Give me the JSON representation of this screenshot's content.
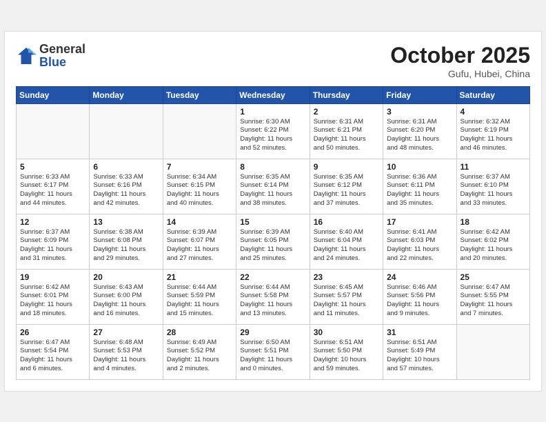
{
  "header": {
    "logo_general": "General",
    "logo_blue": "Blue",
    "month_title": "October 2025",
    "location": "Gufu, Hubei, China"
  },
  "weekdays": [
    "Sunday",
    "Monday",
    "Tuesday",
    "Wednesday",
    "Thursday",
    "Friday",
    "Saturday"
  ],
  "weeks": [
    [
      {
        "day": "",
        "info": ""
      },
      {
        "day": "",
        "info": ""
      },
      {
        "day": "",
        "info": ""
      },
      {
        "day": "1",
        "info": "Sunrise: 6:30 AM\nSunset: 6:22 PM\nDaylight: 11 hours\nand 52 minutes."
      },
      {
        "day": "2",
        "info": "Sunrise: 6:31 AM\nSunset: 6:21 PM\nDaylight: 11 hours\nand 50 minutes."
      },
      {
        "day": "3",
        "info": "Sunrise: 6:31 AM\nSunset: 6:20 PM\nDaylight: 11 hours\nand 48 minutes."
      },
      {
        "day": "4",
        "info": "Sunrise: 6:32 AM\nSunset: 6:19 PM\nDaylight: 11 hours\nand 46 minutes."
      }
    ],
    [
      {
        "day": "5",
        "info": "Sunrise: 6:33 AM\nSunset: 6:17 PM\nDaylight: 11 hours\nand 44 minutes."
      },
      {
        "day": "6",
        "info": "Sunrise: 6:33 AM\nSunset: 6:16 PM\nDaylight: 11 hours\nand 42 minutes."
      },
      {
        "day": "7",
        "info": "Sunrise: 6:34 AM\nSunset: 6:15 PM\nDaylight: 11 hours\nand 40 minutes."
      },
      {
        "day": "8",
        "info": "Sunrise: 6:35 AM\nSunset: 6:14 PM\nDaylight: 11 hours\nand 38 minutes."
      },
      {
        "day": "9",
        "info": "Sunrise: 6:35 AM\nSunset: 6:12 PM\nDaylight: 11 hours\nand 37 minutes."
      },
      {
        "day": "10",
        "info": "Sunrise: 6:36 AM\nSunset: 6:11 PM\nDaylight: 11 hours\nand 35 minutes."
      },
      {
        "day": "11",
        "info": "Sunrise: 6:37 AM\nSunset: 6:10 PM\nDaylight: 11 hours\nand 33 minutes."
      }
    ],
    [
      {
        "day": "12",
        "info": "Sunrise: 6:37 AM\nSunset: 6:09 PM\nDaylight: 11 hours\nand 31 minutes."
      },
      {
        "day": "13",
        "info": "Sunrise: 6:38 AM\nSunset: 6:08 PM\nDaylight: 11 hours\nand 29 minutes."
      },
      {
        "day": "14",
        "info": "Sunrise: 6:39 AM\nSunset: 6:07 PM\nDaylight: 11 hours\nand 27 minutes."
      },
      {
        "day": "15",
        "info": "Sunrise: 6:39 AM\nSunset: 6:05 PM\nDaylight: 11 hours\nand 25 minutes."
      },
      {
        "day": "16",
        "info": "Sunrise: 6:40 AM\nSunset: 6:04 PM\nDaylight: 11 hours\nand 24 minutes."
      },
      {
        "day": "17",
        "info": "Sunrise: 6:41 AM\nSunset: 6:03 PM\nDaylight: 11 hours\nand 22 minutes."
      },
      {
        "day": "18",
        "info": "Sunrise: 6:42 AM\nSunset: 6:02 PM\nDaylight: 11 hours\nand 20 minutes."
      }
    ],
    [
      {
        "day": "19",
        "info": "Sunrise: 6:42 AM\nSunset: 6:01 PM\nDaylight: 11 hours\nand 18 minutes."
      },
      {
        "day": "20",
        "info": "Sunrise: 6:43 AM\nSunset: 6:00 PM\nDaylight: 11 hours\nand 16 minutes."
      },
      {
        "day": "21",
        "info": "Sunrise: 6:44 AM\nSunset: 5:59 PM\nDaylight: 11 hours\nand 15 minutes."
      },
      {
        "day": "22",
        "info": "Sunrise: 6:44 AM\nSunset: 5:58 PM\nDaylight: 11 hours\nand 13 minutes."
      },
      {
        "day": "23",
        "info": "Sunrise: 6:45 AM\nSunset: 5:57 PM\nDaylight: 11 hours\nand 11 minutes."
      },
      {
        "day": "24",
        "info": "Sunrise: 6:46 AM\nSunset: 5:56 PM\nDaylight: 11 hours\nand 9 minutes."
      },
      {
        "day": "25",
        "info": "Sunrise: 6:47 AM\nSunset: 5:55 PM\nDaylight: 11 hours\nand 7 minutes."
      }
    ],
    [
      {
        "day": "26",
        "info": "Sunrise: 6:47 AM\nSunset: 5:54 PM\nDaylight: 11 hours\nand 6 minutes."
      },
      {
        "day": "27",
        "info": "Sunrise: 6:48 AM\nSunset: 5:53 PM\nDaylight: 11 hours\nand 4 minutes."
      },
      {
        "day": "28",
        "info": "Sunrise: 6:49 AM\nSunset: 5:52 PM\nDaylight: 11 hours\nand 2 minutes."
      },
      {
        "day": "29",
        "info": "Sunrise: 6:50 AM\nSunset: 5:51 PM\nDaylight: 11 hours\nand 0 minutes."
      },
      {
        "day": "30",
        "info": "Sunrise: 6:51 AM\nSunset: 5:50 PM\nDaylight: 10 hours\nand 59 minutes."
      },
      {
        "day": "31",
        "info": "Sunrise: 6:51 AM\nSunset: 5:49 PM\nDaylight: 10 hours\nand 57 minutes."
      },
      {
        "day": "",
        "info": ""
      }
    ]
  ]
}
